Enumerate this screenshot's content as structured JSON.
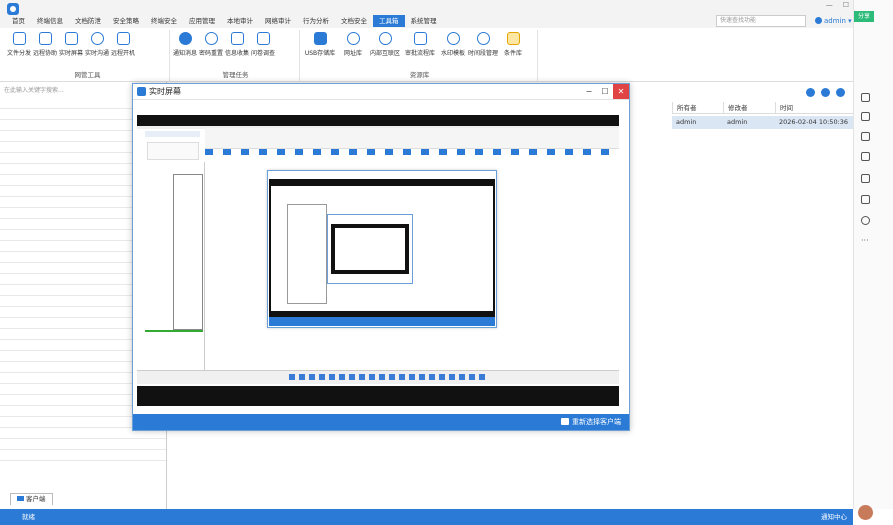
{
  "menu": [
    "首页",
    "终端信息",
    "文档防泄",
    "安全策略",
    "终端安全",
    "应用管理",
    "本地审计",
    "网络审计",
    "行为分析",
    "文档安全",
    "工具箱",
    "系统管理"
  ],
  "menu_active_index": 10,
  "search": {
    "placeholder": "快速查找功能"
  },
  "user": {
    "name": "admin"
  },
  "ribbon_groups": [
    {
      "label": "网管工具",
      "items": [
        "文件分发",
        "远程协助",
        "实时屏幕",
        "实时沟通",
        "远程开机"
      ]
    },
    {
      "label": "管理任务",
      "items": [
        "通知消息",
        "密码重置",
        "信息收集",
        "问卷调查"
      ]
    },
    {
      "label": "资源库",
      "items": [
        "USB存储库",
        "网址库",
        "内部互联区",
        "审批流程库",
        "水印模板",
        "时间段管理",
        "条件库"
      ]
    }
  ],
  "sidebar": {
    "search_placeholder": "在此输入关键字搜索...",
    "tab_label": "客户端"
  },
  "table": {
    "headers": [
      "所有者",
      "修改者",
      "时间"
    ],
    "rows": [
      [
        "admin",
        "admin",
        "2026-02-04 10:50:36"
      ]
    ]
  },
  "dialog": {
    "title": "实时屏幕",
    "footer_button": "重新选择客户端"
  },
  "status": {
    "left": "就绪",
    "right": "通知中心"
  },
  "share_label": "分享",
  "accent_color": "#2a7ad6"
}
